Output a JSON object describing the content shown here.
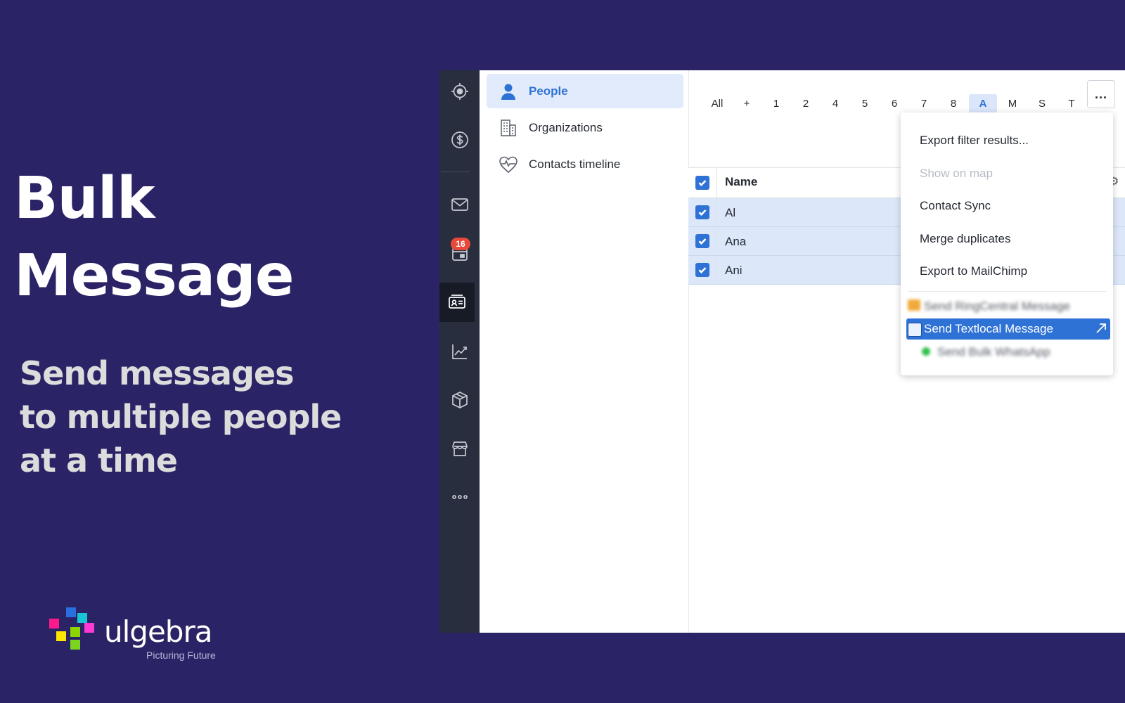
{
  "promo": {
    "headline": [
      "Bulk",
      "Message"
    ],
    "subline": [
      "Send messages",
      "to multiple people",
      "at a time"
    ]
  },
  "logo": {
    "word": "ulgebra",
    "tagline": "Picturing Future"
  },
  "rail": {
    "items": [
      "focus-icon",
      "dollar-icon",
      "mail-icon",
      "calendar-icon",
      "contacts-icon",
      "chart-icon",
      "box-icon",
      "store-icon",
      "more-icon"
    ],
    "calendar_badge": "16"
  },
  "subnav": {
    "items": [
      {
        "label": "People",
        "icon": "person-icon",
        "active": true
      },
      {
        "label": "Organizations",
        "icon": "building-icon",
        "active": false
      },
      {
        "label": "Contacts timeline",
        "icon": "heartbeat-icon",
        "active": false
      }
    ]
  },
  "filter_bar": {
    "letters": [
      "All",
      "+",
      "1",
      "2",
      "4",
      "5",
      "6",
      "7",
      "8",
      "A",
      "M",
      "S",
      "T"
    ],
    "selected": "A",
    "more_label": "..."
  },
  "grid": {
    "header": {
      "name": "Name",
      "checked": true
    },
    "rows": [
      {
        "name": "Al",
        "checked": true
      },
      {
        "name": "Ana",
        "checked": true
      },
      {
        "name": "Ani",
        "checked": true
      }
    ]
  },
  "menu": {
    "items": [
      {
        "label": "Export filter results...",
        "disabled": false
      },
      {
        "label": "Show on map",
        "disabled": true
      },
      {
        "label": "Contact Sync",
        "disabled": false
      },
      {
        "label": "Merge duplicates",
        "disabled": false
      },
      {
        "label": "Export to MailChimp",
        "disabled": false
      }
    ],
    "app_items": [
      {
        "label": "Send RingCentral Message",
        "blurred": true
      },
      {
        "label": "Send Textlocal Message",
        "highlighted": true
      },
      {
        "label": "Send Bulk WhatsApp",
        "blurred": true
      }
    ]
  },
  "colors": {
    "background": "#2a2466",
    "accent": "#2f72d6",
    "badge": "#e8493a",
    "rail": "#282e3d"
  }
}
